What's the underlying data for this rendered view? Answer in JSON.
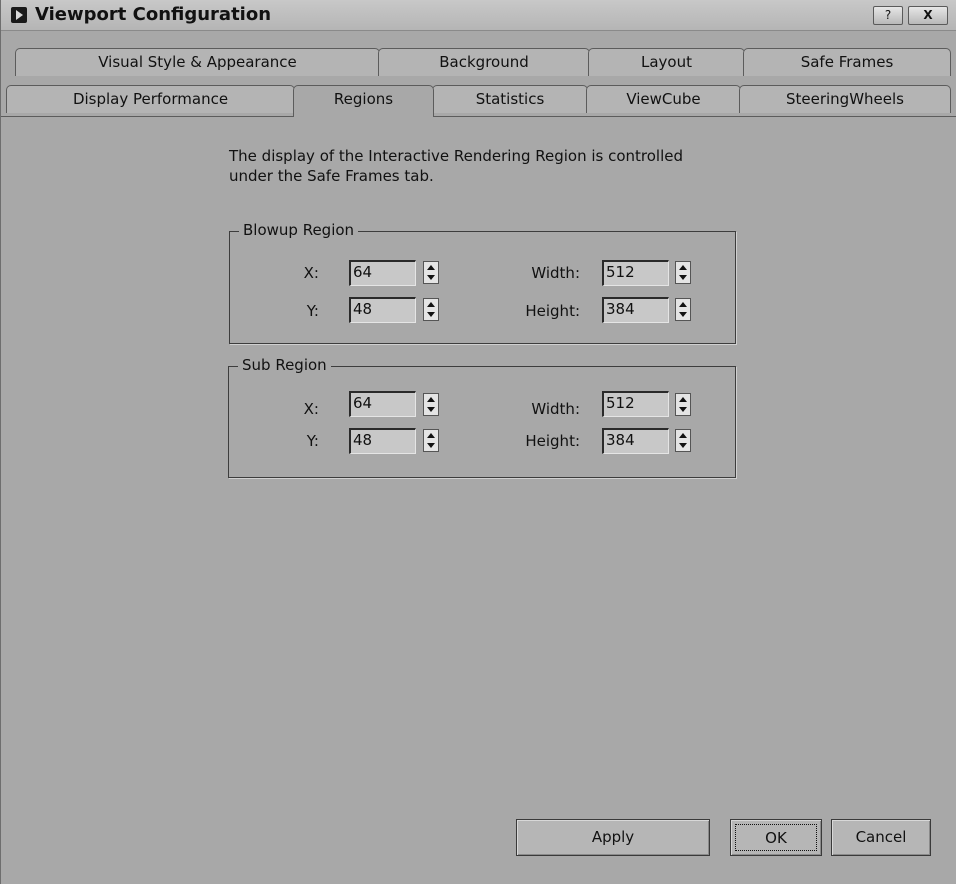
{
  "window": {
    "title": "Viewport Configuration",
    "help_label": "?",
    "close_label": "X"
  },
  "tabs": {
    "row1": [
      "Visual Style & Appearance",
      "Background",
      "Layout",
      "Safe Frames"
    ],
    "row2": [
      "Display Performance",
      "Regions",
      "Statistics",
      "ViewCube",
      "SteeringWheels"
    ],
    "active": "Regions"
  },
  "description": {
    "line1": "The display of the Interactive Rendering Region is controlled",
    "line2": "under the Safe Frames tab."
  },
  "blowup": {
    "label": "Blowup Region",
    "x_label": "X:",
    "x_value": "64",
    "y_label": "Y:",
    "y_value": "48",
    "width_label": "Width:",
    "width_value": "512",
    "height_label": "Height:",
    "height_value": "384"
  },
  "sub": {
    "label": "Sub Region",
    "x_label": "X:",
    "x_value": "64",
    "y_label": "Y:",
    "y_value": "48",
    "width_label": "Width:",
    "width_value": "512",
    "height_label": "Height:",
    "height_value": "384"
  },
  "buttons": {
    "apply": "Apply",
    "ok": "OK",
    "cancel": "Cancel"
  },
  "colors": {
    "dialog_bg": "#a8a8a8",
    "tab_bg": "#b4b4b4"
  }
}
